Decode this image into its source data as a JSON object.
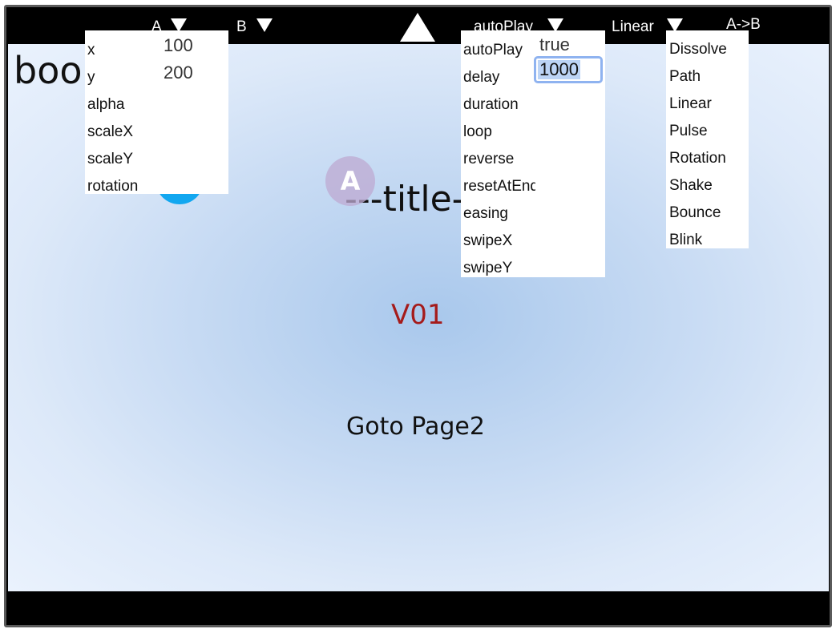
{
  "topbar": {
    "a_label": "A",
    "b_label": "B",
    "autoplay_label": "autoPlay",
    "easing_label": "Linear",
    "direction_label": "A->B"
  },
  "stage": {
    "book_text": "book",
    "title_text": "---title---",
    "badge_text": "A",
    "version_text": "V01",
    "goto_text": "Goto Page2"
  },
  "props_panel": {
    "rows": [
      "x",
      "y",
      "alpha",
      "scaleX",
      "scaleY",
      "rotation"
    ],
    "x_value": "100",
    "y_value": "200"
  },
  "anim_panel": {
    "rows": [
      "autoPlay",
      "delay",
      "duration",
      "loop",
      "reverse",
      "resetAtEnd",
      "easing",
      "swipeX",
      "swipeY"
    ],
    "autoplay_value": "true",
    "delay_value": "1000"
  },
  "effect_menu": {
    "items": [
      "Dissolve",
      "Path",
      "Linear",
      "Pulse",
      "Rotation",
      "Shake",
      "Bounce",
      "Blink"
    ]
  },
  "colors": {
    "accent_blue": "#12a7f0",
    "version_red": "#a51b1b",
    "input_focus": "#8fb3f0"
  }
}
